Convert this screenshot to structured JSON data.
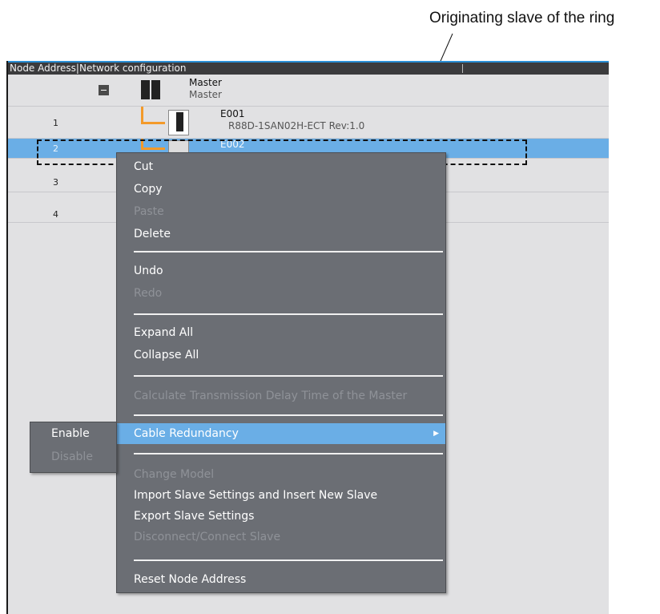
{
  "callout": {
    "text": "Originating slave of the ring"
  },
  "panel": {
    "header_label": "Node Address|Network configuration",
    "rows": [
      {
        "address": "",
        "name": "Master",
        "model": "Master"
      },
      {
        "address": "1",
        "name": "E001",
        "model": "R88D-1SAN02H-ECT Rev:1.0"
      },
      {
        "address": "2",
        "name": "E002",
        "model": ""
      },
      {
        "address": "3",
        "name": "",
        "model": ""
      },
      {
        "address": "4",
        "name": "",
        "model": ""
      }
    ]
  },
  "context_menu": {
    "cut": "Cut",
    "copy": "Copy",
    "paste": "Paste",
    "delete": "Delete",
    "undo": "Undo",
    "redo": "Redo",
    "expand_all": "Expand All",
    "collapse_all": "Collapse All",
    "calc_delay": "Calculate Transmission Delay Time of the Master",
    "cable_redundancy": "Cable Redundancy",
    "change_model": "Change Model",
    "import_slave": "Import Slave Settings and Insert New Slave",
    "export_slave": "Export Slave Settings",
    "disconnect_slave": "Disconnect/Connect Slave",
    "reset_node": "Reset Node Address"
  },
  "submenu": {
    "enable": "Enable",
    "disable": "Disable"
  },
  "colors": {
    "selection": "#6aaee6",
    "menu_bg": "#6b6e74",
    "wire": "#f39a2a",
    "header_bg": "#3b3b3d"
  }
}
